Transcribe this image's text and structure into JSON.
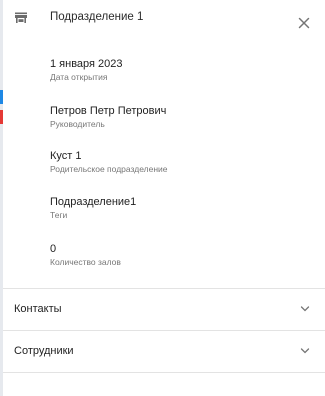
{
  "header": {
    "title": "Подразделение 1",
    "icon": "store-icon",
    "close_icon": "close-icon"
  },
  "fields": [
    {
      "value": "1 января 2023",
      "label": "Дата открытия"
    },
    {
      "value": "Петров Петр Петрович",
      "label": "Руководитель"
    },
    {
      "value": "Куст 1",
      "label": "Родительское подразделение"
    },
    {
      "value": "Подразделение1",
      "label": "Теги"
    },
    {
      "value": "0",
      "label": "Количество залов"
    }
  ],
  "sections": [
    {
      "label": "Контакты",
      "icon": "chevron-down-icon"
    },
    {
      "label": "Сотрудники",
      "icon": "chevron-down-icon"
    }
  ],
  "colors": {
    "accent_blue": "#1e88e5",
    "accent_red": "#e53935",
    "divider": "#e3e3e3"
  }
}
